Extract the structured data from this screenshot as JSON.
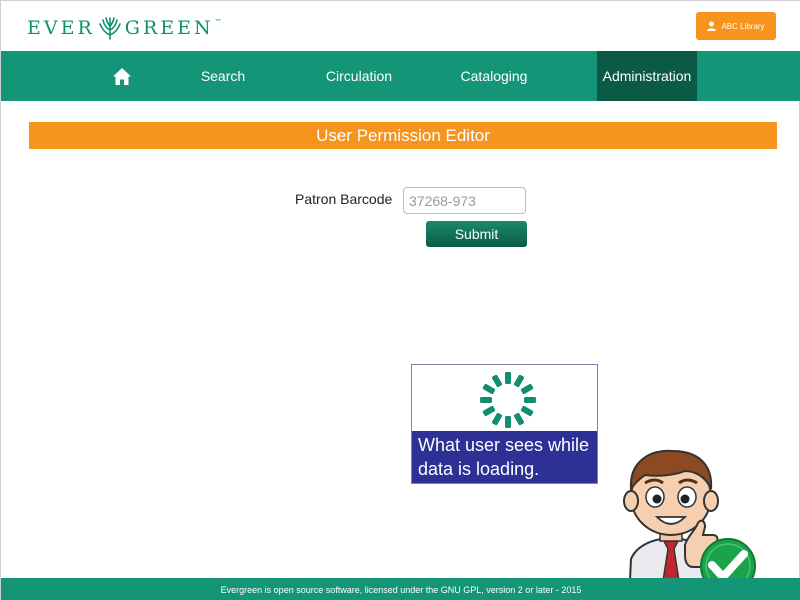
{
  "header": {
    "logo_text_left": "EVER",
    "logo_text_right": "GREEN",
    "logo_tm": "™",
    "library_button": "ABC Library"
  },
  "nav": {
    "items": [
      {
        "label": "Search"
      },
      {
        "label": "Circulation"
      },
      {
        "label": "Cataloging"
      },
      {
        "label": "Administration",
        "active": true
      }
    ]
  },
  "main": {
    "title": "User Permission Editor",
    "patron_label": "Patron Barcode",
    "patron_placeholder": "37268-973",
    "submit_label": "Submit"
  },
  "loading": {
    "caption": "What user sees while data is loading."
  },
  "footer": {
    "text": "Evergreen is open source software, licensed under the GNU GPL, version 2 or later - 2015"
  },
  "colors": {
    "brand_green": "#149578",
    "active_green": "#0b5a45",
    "accent_orange": "#f6941d",
    "loading_blue": "#2d3196"
  }
}
